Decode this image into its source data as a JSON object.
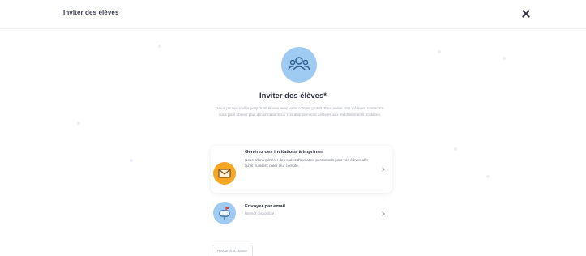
{
  "header": {
    "title": "Inviter des élèves",
    "close_icon": "close-icon"
  },
  "hero": {
    "icon": "people-icon",
    "title": "Inviter des élèves*",
    "description": "*Vous pouvez inviter jusqu'à 40 élèves avec votre compte gratuit. Pour inviter plus d'élèves, contactez-nous pour obtenir plus d'informations sur nos abonnements destinés aux établissements scolaires."
  },
  "options": [
    {
      "icon": "envelope-print-icon",
      "title": "Générez des invitations à imprimer",
      "description": "Nous allons générer des codes d'invitation personnels pour vos élèves afin qu'ils puissent créer leur compte."
    },
    {
      "icon": "mailbox-icon",
      "title": "Envoyer par email",
      "subtitle": "Bientôt disponible !"
    }
  ],
  "footer": {
    "back_label": "Retour à la classe"
  },
  "colors": {
    "hero_circle": "#9fcbf2",
    "print_icon": "#f5a623",
    "email_icon": "#9fcbf2",
    "text_dark": "#2d2f40",
    "text_muted": "#a3a7b4"
  }
}
